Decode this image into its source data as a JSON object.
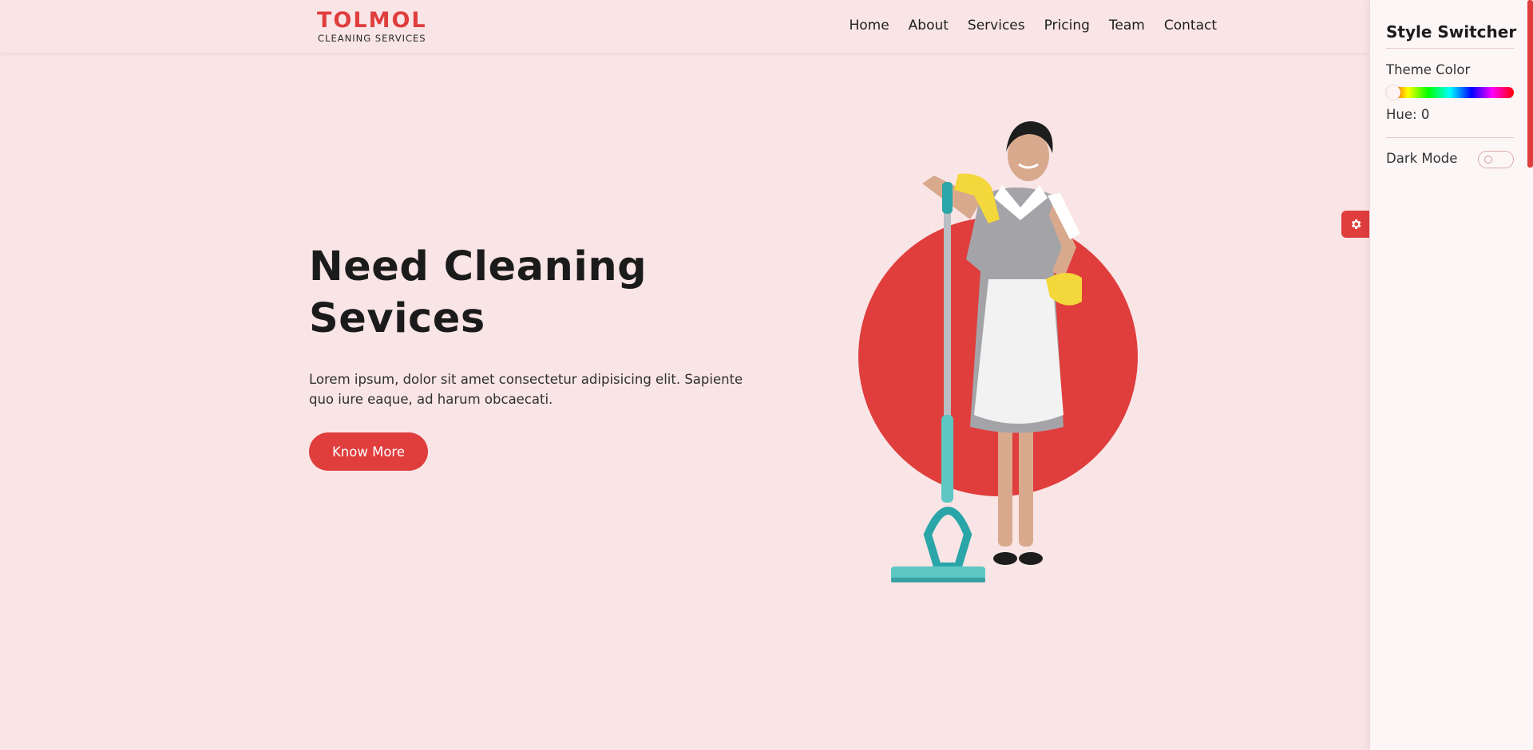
{
  "brand": {
    "name": "TOLMOL",
    "tagline": "CLEANING SERVICES",
    "accent_color": "#e03d3d"
  },
  "nav": {
    "items": [
      {
        "label": "Home"
      },
      {
        "label": "About"
      },
      {
        "label": "Services"
      },
      {
        "label": "Pricing"
      },
      {
        "label": "Team"
      },
      {
        "label": "Contact"
      }
    ]
  },
  "hero": {
    "heading_line1": "Need Cleaning",
    "heading_line2": "Sevices",
    "text": "Lorem ipsum, dolor sit amet consectetur adipisicing elit. Sapiente quo iure eaque, ad harum obcaecati.",
    "button_label": "Know More",
    "image": "cleaning-woman-with-mop"
  },
  "settings_toggle": {
    "icon": "gear-icon"
  },
  "style_switcher": {
    "title": "Style Switcher",
    "theme_color_label": "Theme Color",
    "hue_label": "Hue: 0",
    "hue_value": 0,
    "dark_mode_label": "Dark Mode",
    "dark_mode_on": false
  },
  "colors": {
    "background": "#f9e5e6",
    "panel_background": "#fdf6f6",
    "accent": "#e03d3d"
  }
}
